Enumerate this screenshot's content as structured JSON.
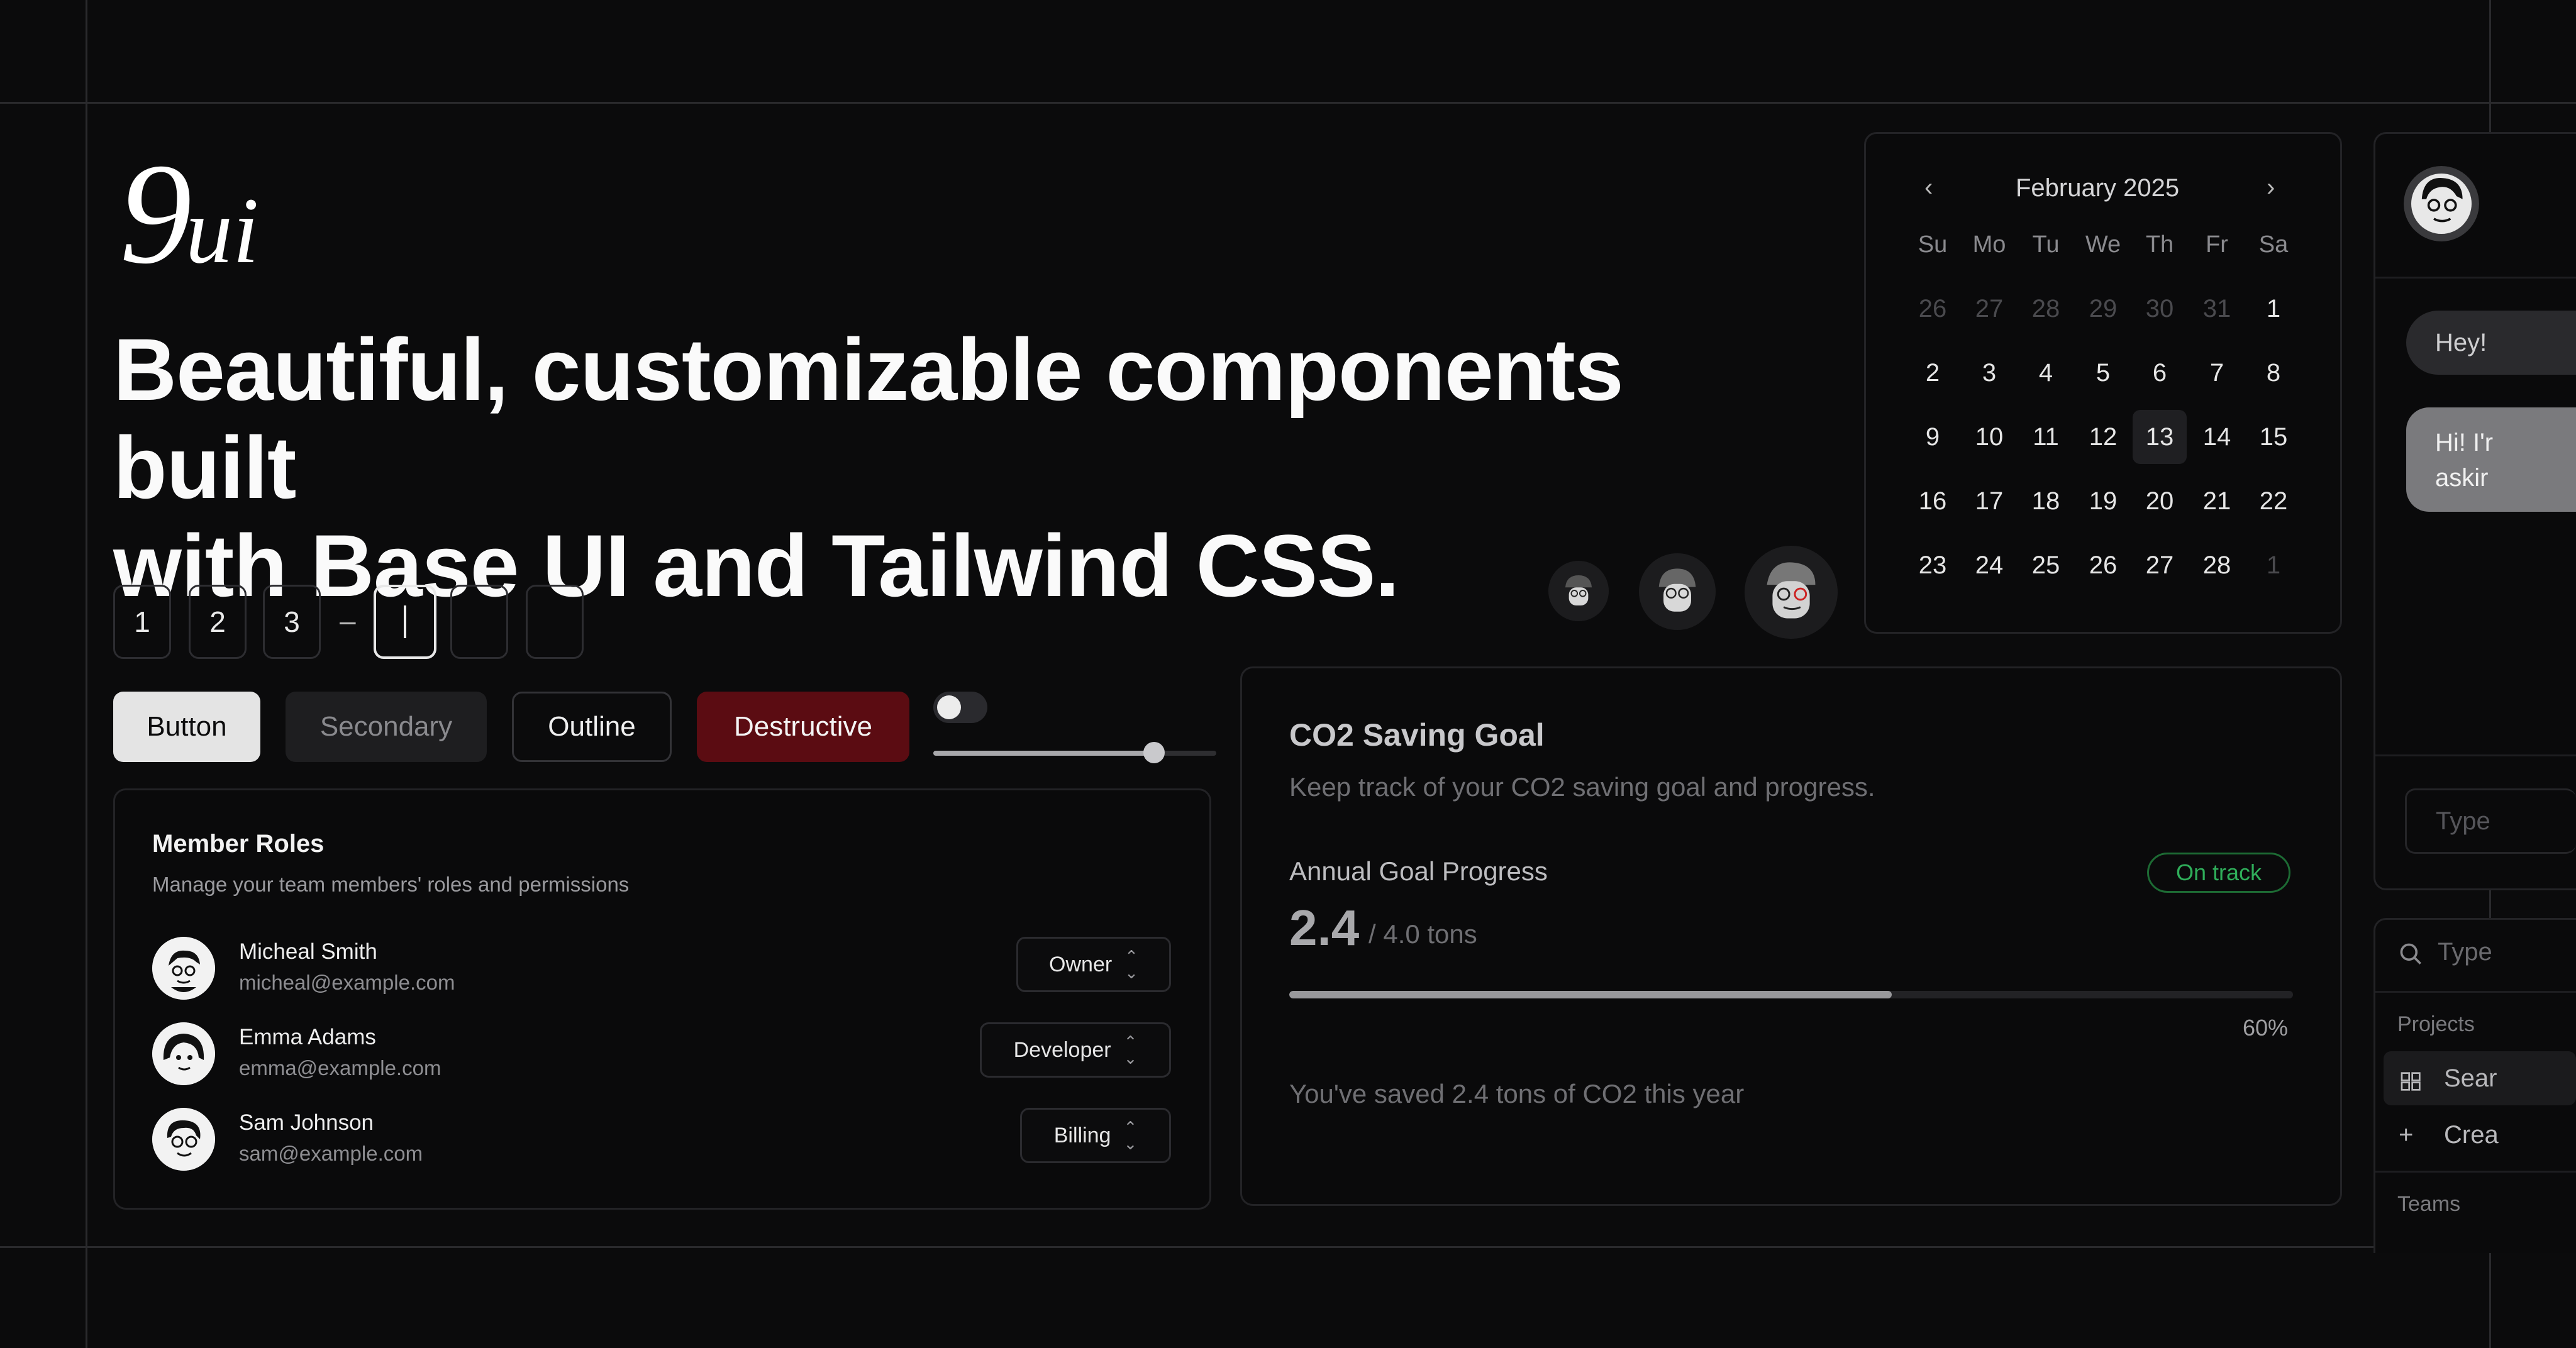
{
  "logo": {
    "nine": "9",
    "ui": "ui"
  },
  "hero": {
    "headline_line1": "Beautiful, customizable components built",
    "headline_line2": "with Base UI and Tailwind CSS."
  },
  "otp": {
    "digits": [
      "1",
      "2",
      "3",
      "",
      "",
      ""
    ],
    "separator": "–"
  },
  "buttons": {
    "primary": "Button",
    "secondary": "Secondary",
    "outline": "Outline",
    "destructive": "Destructive"
  },
  "toggle": {
    "on": false
  },
  "slider": {
    "value_percent": 80
  },
  "member_roles": {
    "title": "Member Roles",
    "description": "Manage your team members' roles and permissions",
    "members": [
      {
        "name": "Micheal Smith",
        "email": "micheal@example.com",
        "role": "Owner"
      },
      {
        "name": "Emma Adams",
        "email": "emma@example.com",
        "role": "Developer"
      },
      {
        "name": "Sam Johnson",
        "email": "sam@example.com",
        "role": "Billing"
      }
    ]
  },
  "calendar": {
    "month_label": "February 2025",
    "prev_icon": "chevron-left-icon",
    "next_icon": "chevron-right-icon",
    "weekdays": [
      "Su",
      "Mo",
      "Tu",
      "We",
      "Th",
      "Fr",
      "Sa"
    ],
    "weeks": [
      [
        "26",
        "27",
        "28",
        "29",
        "30",
        "31",
        "1"
      ],
      [
        "2",
        "3",
        "4",
        "5",
        "6",
        "7",
        "8"
      ],
      [
        "9",
        "10",
        "11",
        "12",
        "13",
        "14",
        "15"
      ],
      [
        "16",
        "17",
        "18",
        "19",
        "20",
        "21",
        "22"
      ],
      [
        "23",
        "24",
        "25",
        "26",
        "27",
        "28",
        "1"
      ]
    ],
    "selected": "13"
  },
  "co2": {
    "title": "CO2 Saving Goal",
    "description": "Keep track of your CO2 saving goal and progress.",
    "progress_label": "Annual Goal Progress",
    "status_badge": "On track",
    "value": "2.4",
    "target": "/ 4.0 tons",
    "progress_percent": 60,
    "progress_text": "60%",
    "footer": "You've saved 2.4 tons of CO2 this year"
  },
  "chat": {
    "bubble_1": "Hey!",
    "bubble_2_line1": "Hi! I'r",
    "bubble_2_line2": "askir",
    "input_placeholder": "Type"
  },
  "command": {
    "search_placeholder": "Type",
    "group_projects": "Projects",
    "item_search": "Sear",
    "item_create": "Crea",
    "group_teams": "Teams"
  },
  "colors": {
    "background": "#0b0b0c",
    "destructive": "#5b0c12",
    "success": "#2fae5a"
  }
}
